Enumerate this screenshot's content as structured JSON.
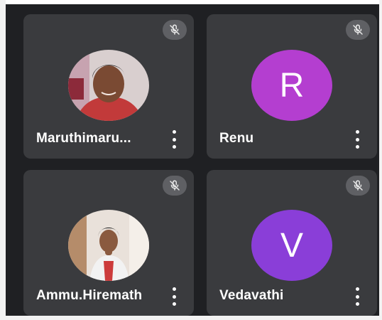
{
  "participants": [
    {
      "name": "Maruthimaru...",
      "avatar_type": "photo",
      "avatar_icon": "person-photo-maruthimaru",
      "muted": true
    },
    {
      "name": "Renu",
      "avatar_type": "initial",
      "initial": "R",
      "avatar_color": "#b43ed0",
      "muted": true
    },
    {
      "name": "Ammu.Hiremath",
      "avatar_type": "photo",
      "avatar_icon": "person-photo-ammu",
      "muted": true
    },
    {
      "name": "Vedavathi",
      "avatar_type": "initial",
      "initial": "V",
      "avatar_color": "#8a3ed8",
      "muted": true
    }
  ],
  "icons": {
    "mute": "mic-off-icon",
    "more": "more-vertical-icon"
  },
  "colors": {
    "background": "#1f2023",
    "tile": "#3a3b3e",
    "mute_badge": "#5f6064"
  }
}
